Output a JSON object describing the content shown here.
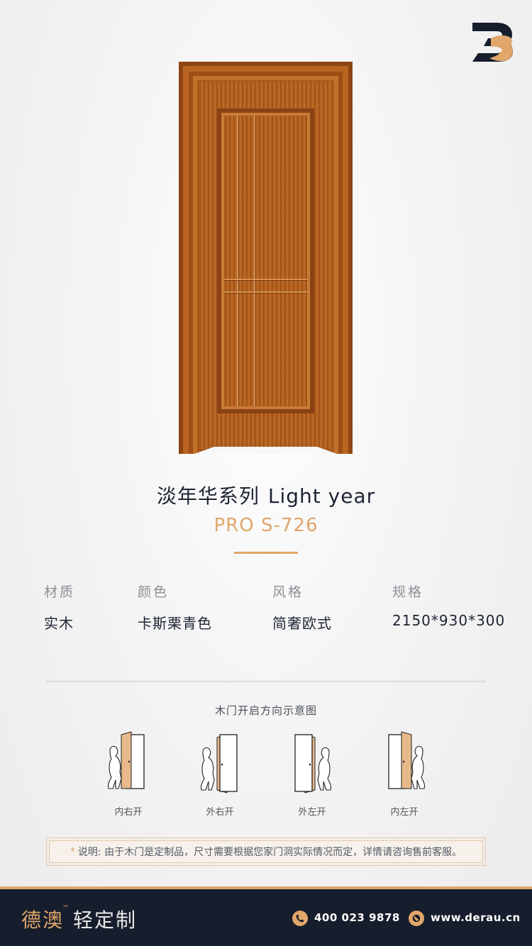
{
  "brand_colors": {
    "accent": "#e0a66a",
    "navy": "#161d2c",
    "wood": "#b5631f"
  },
  "product": {
    "title_cn": "淡年华系列",
    "title_en": "Light year",
    "model": "PRO S-726"
  },
  "specs": [
    {
      "label": "材质",
      "value": "实木"
    },
    {
      "label": "颜色",
      "value": "卡斯栗青色"
    },
    {
      "label": "风格",
      "value": "简奢欧式"
    },
    {
      "label": "规格",
      "value": "2150*930*300"
    }
  ],
  "diagram": {
    "title": "木门开启方向示意图",
    "items": [
      {
        "label": "内右开",
        "icon": "door-inward-right-icon"
      },
      {
        "label": "外右开",
        "icon": "door-outward-right-icon"
      },
      {
        "label": "外左开",
        "icon": "door-outward-left-icon"
      },
      {
        "label": "内左开",
        "icon": "door-inward-left-icon"
      }
    ]
  },
  "note": {
    "mark": "*",
    "text": "说明: 由于木门是定制品，尺寸需要根据您家门洞实际情况而定，详情请咨询售前客服。"
  },
  "footer": {
    "brand_name": "德澳",
    "trademark": "™",
    "brand_sub": "轻定制",
    "phone_icon": "phone-icon",
    "phone": "400 023 9878",
    "web_icon": "globe-icon",
    "website": "www.derau.cn"
  }
}
